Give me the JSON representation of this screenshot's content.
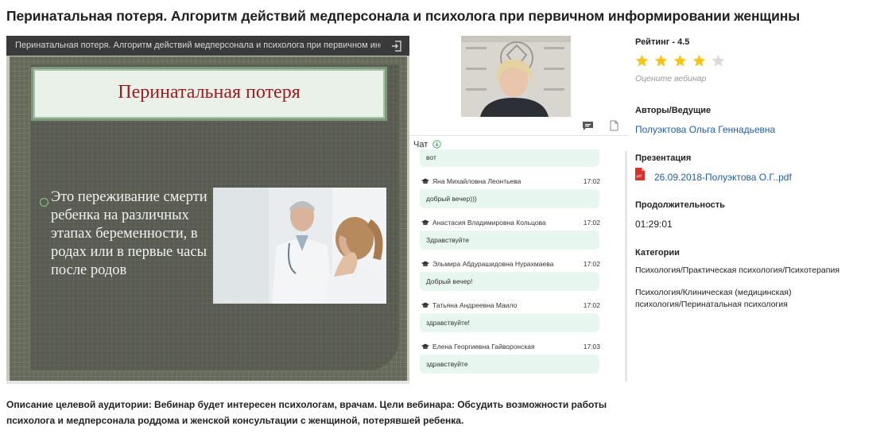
{
  "page": {
    "title": "Перинатальная потеря. Алгоритм действий медперсонала и психолога при первичном информировании женщины"
  },
  "player": {
    "bar_title": "Перинатальная потеря. Алгоритм действий медперсонала и психолога при первичном инфо...",
    "slide": {
      "title": "Перинатальная  потеря",
      "bullet": "Это переживание смерти ребенка на различных этапах беременности, в родах или в первые часы после родов"
    }
  },
  "chat": {
    "header": "Чат",
    "first_bubble": "вот",
    "messages": [
      {
        "author": "Яна Михайловна Леонтьева",
        "time": "17:02",
        "text": "добрый вечер)))"
      },
      {
        "author": "Анастасия Владимировна Кольцова",
        "time": "17:02",
        "text": "Здравствуйте"
      },
      {
        "author": "Эльмира Абдурашидовна Нурахмаева",
        "time": "17:02",
        "text": "Добрый вечер!"
      },
      {
        "author": "Татьяна Андреевна Маило",
        "time": "17:02",
        "text": "здравствуйте!"
      },
      {
        "author": "Елена Георгиевна Гайворонская",
        "time": "17:03",
        "text": "здравствуйте"
      }
    ]
  },
  "sidebar": {
    "rating_label": "Рейтинг - 4.5",
    "rating_value": 4.5,
    "rating_max": 5,
    "rate_hint": "Оцените вебинар",
    "authors_label": "Авторы/Ведущие",
    "author": "Полуэктова Ольга Геннадьевна",
    "presentation_label": "Презентация",
    "presentation_file": "26.09.2018-Полуэктова О.Г..pdf",
    "duration_label": "Продолжительность",
    "duration": "01:29:01",
    "categories_label": "Категории",
    "categories": [
      "Психология/Практическая психология/Психотерапия",
      "Психология/Клиническая (медицинская) психология/Перинатальная психология"
    ]
  },
  "description": "Описание целевой аудитории: Вебинар будет интересен психологам, врачам. Цели вебинара: Обсудить возможности работы психолога и медперсонала роддома и женской консультации с женщиной, потерявшей ребенка.",
  "colors": {
    "link": "#1f5fa8",
    "star_on": "#f5c518",
    "star_off": "#d9d9d9",
    "chat_bubble": "#e7f6ee",
    "slide_title": "#a01a24"
  }
}
